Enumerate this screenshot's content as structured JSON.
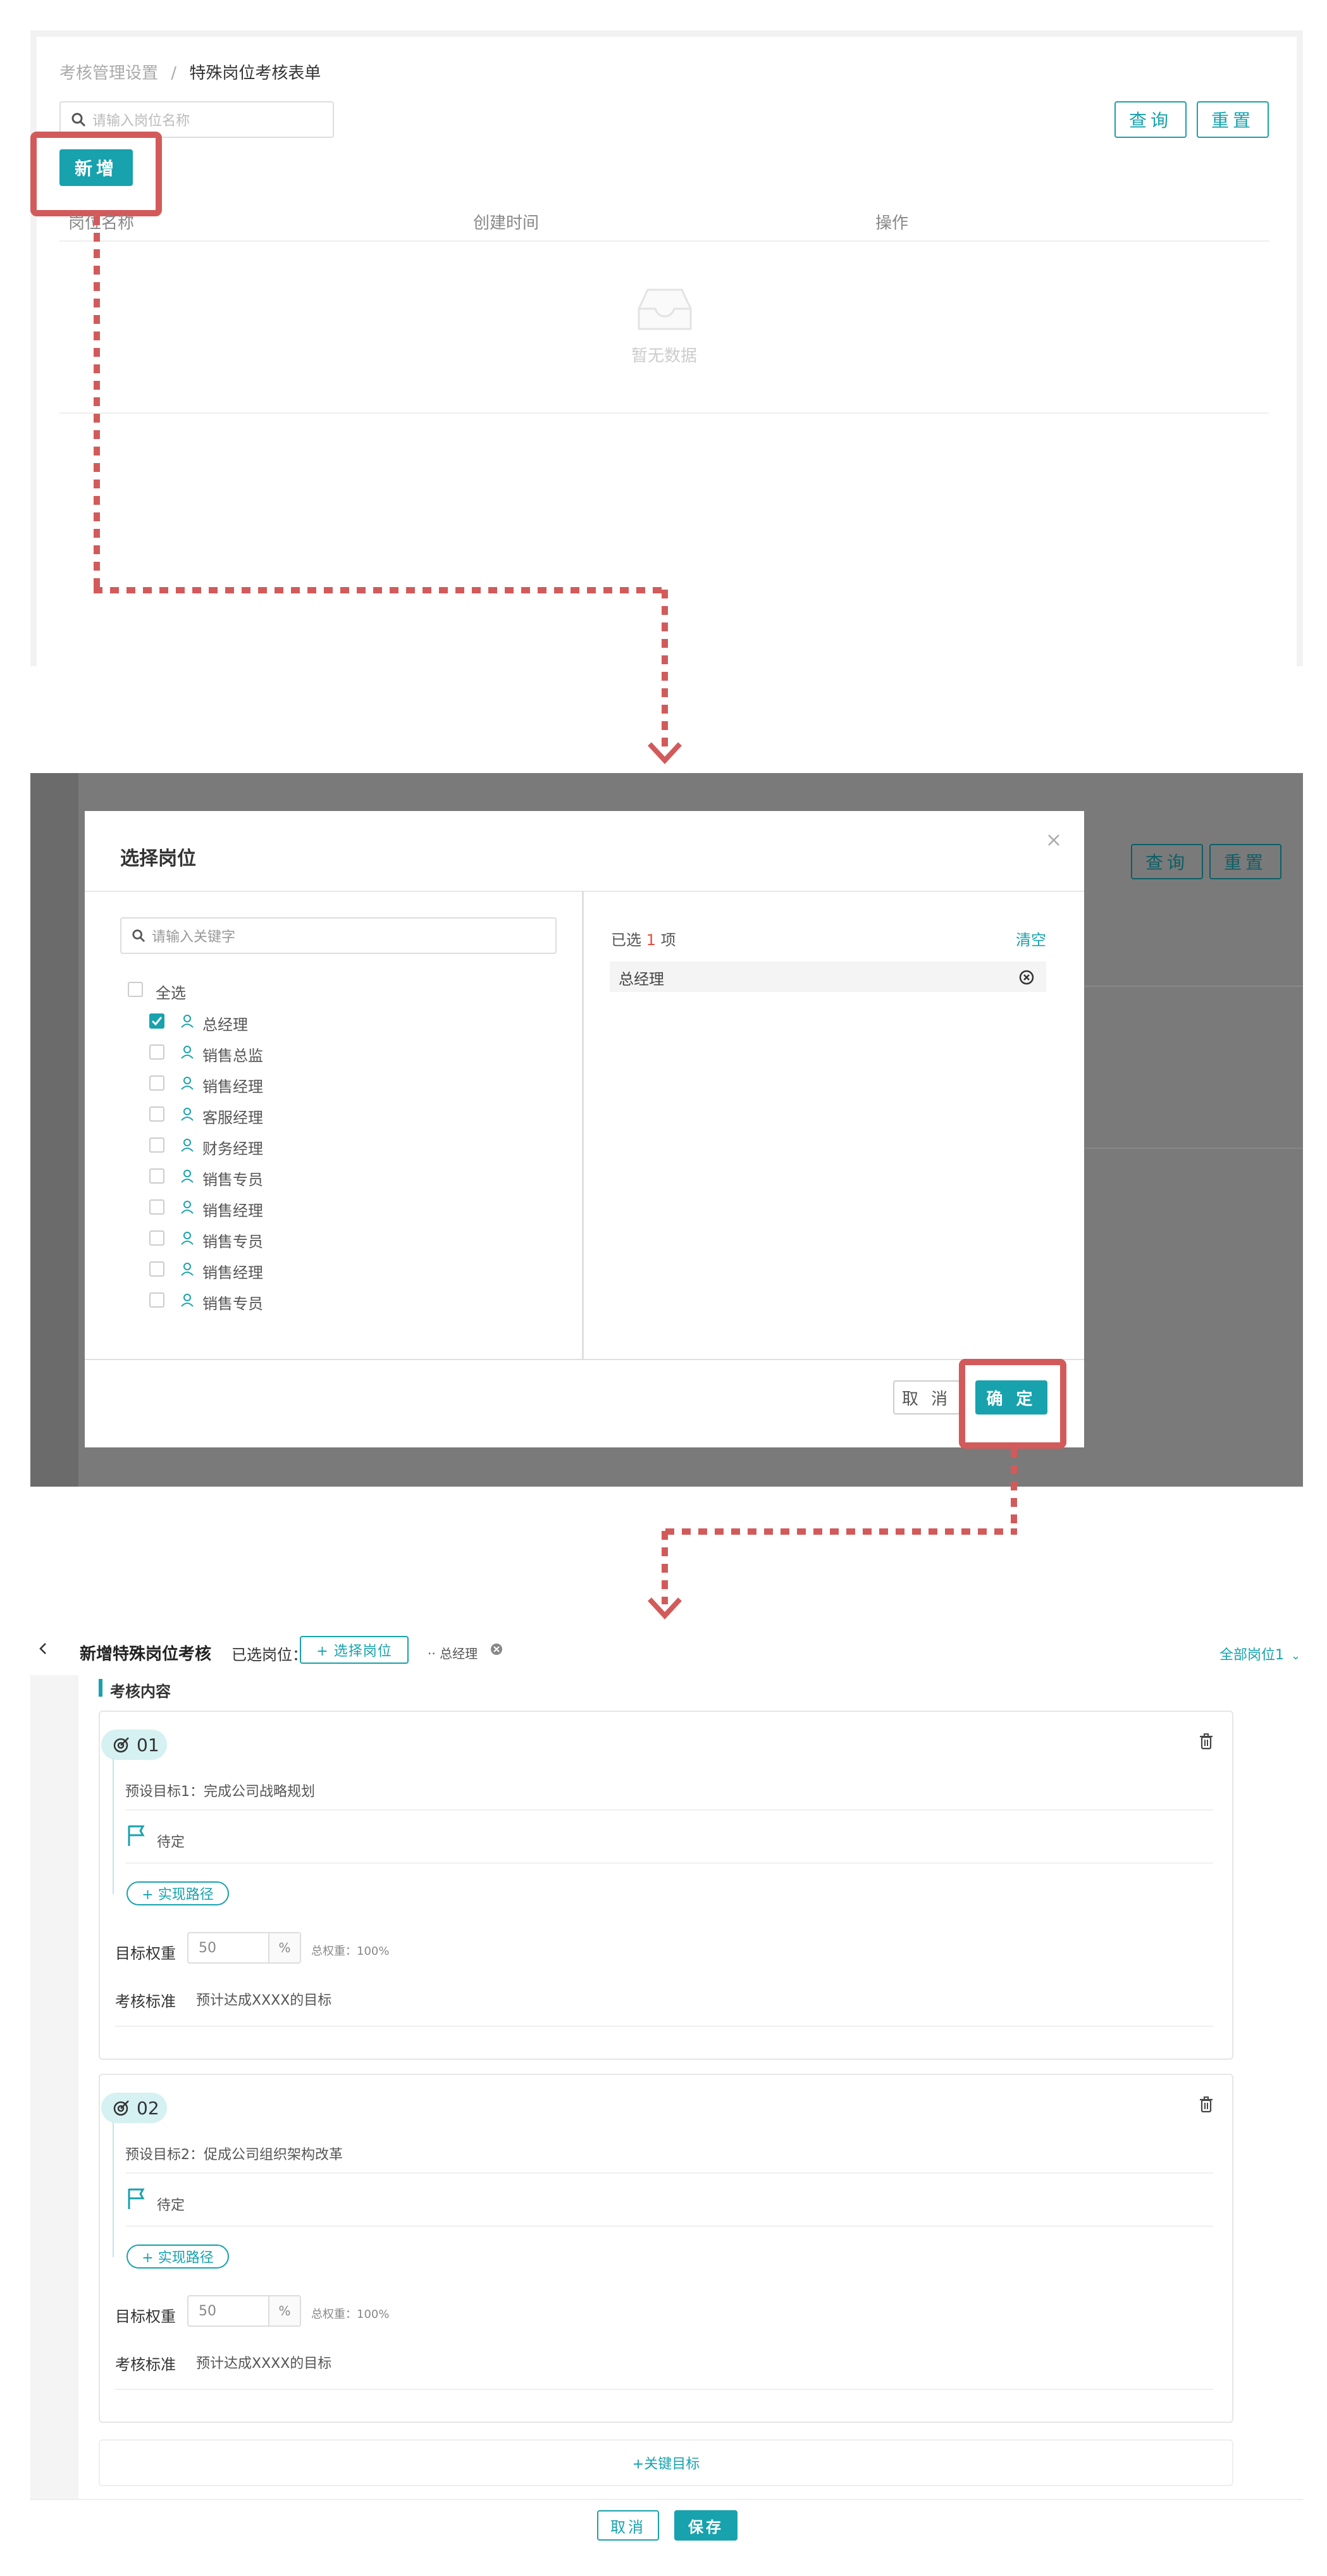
{
  "panel1": {
    "breadcrumb": {
      "parent": "考核管理设置",
      "separator": "/",
      "current": "特殊岗位考核表单"
    },
    "search_placeholder": "请输入岗位名称",
    "query_label": "查询",
    "reset_label": "重置",
    "add_label": "新增",
    "columns": [
      "岗位名称",
      "创建时间",
      "操作"
    ],
    "empty_text": "暂无数据"
  },
  "panel2": {
    "bg_query": "查询",
    "bg_reset": "重置",
    "modal_title": "选择岗位",
    "search_placeholder": "请输入关键字",
    "select_all": "全选",
    "items": [
      {
        "label": "总经理",
        "checked": true
      },
      {
        "label": "销售总监",
        "checked": false
      },
      {
        "label": "销售经理",
        "checked": false
      },
      {
        "label": "客服经理",
        "checked": false
      },
      {
        "label": "财务经理",
        "checked": false
      },
      {
        "label": "销售专员",
        "checked": false
      },
      {
        "label": "销售经理",
        "checked": false
      },
      {
        "label": "销售专员",
        "checked": false
      },
      {
        "label": "销售经理",
        "checked": false
      },
      {
        "label": "销售专员",
        "checked": false
      }
    ],
    "selected_prefix": "已选",
    "selected_count": "1",
    "selected_suffix": "项",
    "clear_label": "清空",
    "selected_items": [
      "总经理"
    ],
    "cancel_label": "取 消",
    "confirm_label": "确 定"
  },
  "panel3": {
    "title": "新增特殊岗位考核",
    "selected_label": "已选岗位：",
    "choose_btn": "+ 选择岗位",
    "tag": "总经理",
    "all_positions": "全部岗位1",
    "section_title": "考核内容",
    "goals": [
      {
        "num": "01",
        "preset": "预设目标1：完成公司战略规划",
        "status": "待定",
        "path_btn": "+ 实现路径",
        "weight_label": "目标权重",
        "weight_value": "50",
        "unit": "%",
        "total": "总权重：100%",
        "standard_label": "考核标准",
        "standard_text": "预计达成XXXX的目标"
      },
      {
        "num": "02",
        "preset": "预设目标2：促成公司组织架构改革",
        "status": "待定",
        "path_btn": "+ 实现路径",
        "weight_label": "目标权重",
        "weight_value": "50",
        "unit": "%",
        "total": "总权重：100%",
        "standard_label": "考核标准",
        "standard_text": "预计达成XXXX的目标"
      }
    ],
    "add_key_goal": "+关键目标",
    "cancel_label": "取消",
    "save_label": "保存"
  }
}
